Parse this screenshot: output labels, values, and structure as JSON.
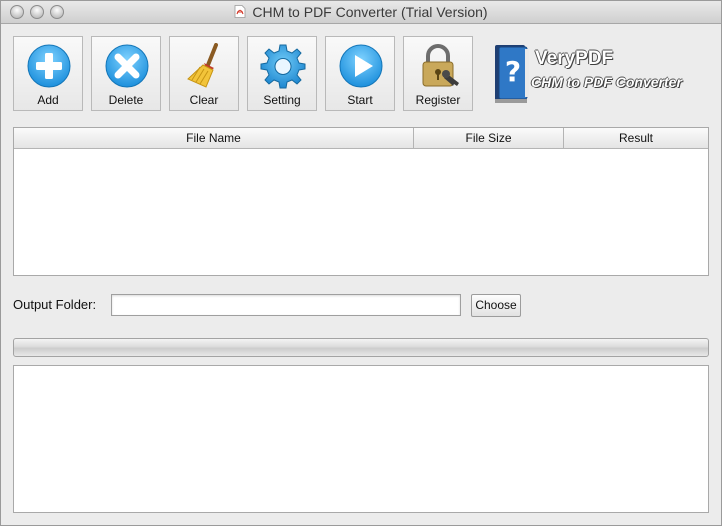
{
  "window": {
    "title": "CHM to PDF Converter (Trial Version)"
  },
  "toolbar": {
    "buttons": [
      {
        "label": "Add",
        "icon": "plus-circle-icon"
      },
      {
        "label": "Delete",
        "icon": "x-circle-icon"
      },
      {
        "label": "Clear",
        "icon": "broom-icon"
      },
      {
        "label": "Setting",
        "icon": "gear-icon"
      },
      {
        "label": "Start",
        "icon": "play-icon"
      },
      {
        "label": "Register",
        "icon": "padlock-key-icon"
      }
    ]
  },
  "logo": {
    "brand": "VeryPDF",
    "product": "CHM to PDF Converter"
  },
  "file_table": {
    "columns": [
      "File Name",
      "File Size",
      "Result"
    ],
    "rows": []
  },
  "output": {
    "label": "Output Folder:",
    "value": "",
    "choose_label": "Choose"
  },
  "progress": {
    "value": 0
  },
  "log": {
    "text": ""
  },
  "colors": {
    "accent_blue": "#2aa1e6",
    "window_bg": "#ececec"
  }
}
